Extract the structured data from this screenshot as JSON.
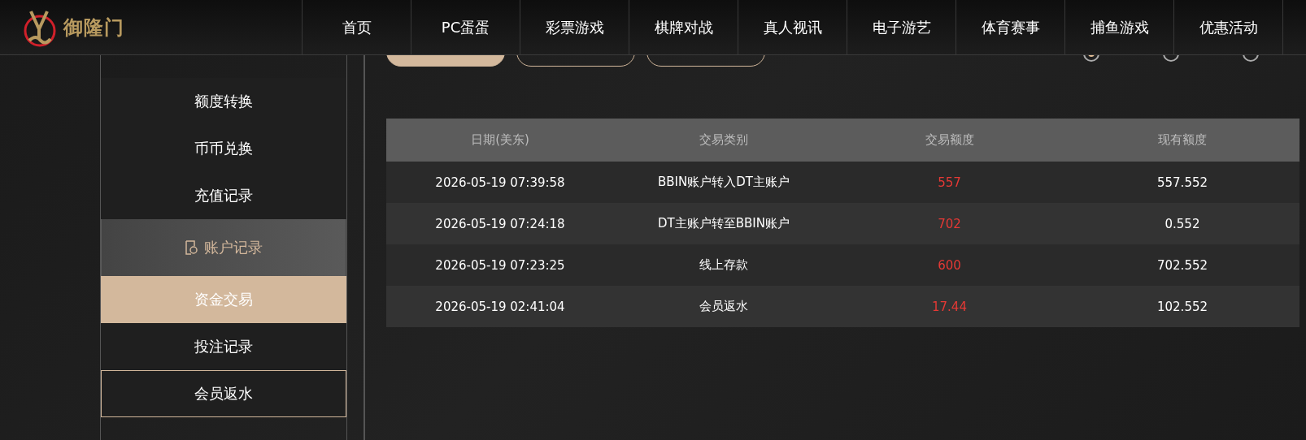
{
  "header": {
    "logo": {
      "name": "御隆门"
    },
    "nav": [
      {
        "label": "首页"
      },
      {
        "label": "PC蛋蛋"
      },
      {
        "label": "彩票游戏"
      },
      {
        "label": "棋牌对战"
      },
      {
        "label": "真人视讯"
      },
      {
        "label": "电子游艺"
      },
      {
        "label": "体育赛事"
      },
      {
        "label": "捕鱼游戏"
      },
      {
        "label": "优惠活动"
      }
    ]
  },
  "sidebar": {
    "items": [
      {
        "kind": "link",
        "selected": false,
        "highlighted": false
      },
      {
        "kind": "link",
        "label": "额度转换",
        "selected": false,
        "highlighted": false
      },
      {
        "kind": "link",
        "label": "币币兑换",
        "selected": false,
        "highlighted": false
      },
      {
        "kind": "link",
        "label": "充值记录",
        "selected": false,
        "highlighted": false
      },
      {
        "kind": "group",
        "label": "账户记录",
        "selected": false,
        "highlighted": false
      },
      {
        "kind": "link",
        "label": "资金交易",
        "selected": true,
        "highlighted": false
      },
      {
        "kind": "link",
        "label": "投注记录",
        "selected": false,
        "highlighted": false
      },
      {
        "kind": "link",
        "label": "会员返水",
        "selected": false,
        "highlighted": true
      },
      {
        "kind": "link",
        "selected": false,
        "highlighted": false
      }
    ]
  },
  "filters": [
    {
      "selected": true
    },
    {
      "selected": false
    },
    {
      "selected": false
    }
  ],
  "periods": [
    {
      "selected": true
    },
    {
      "selected": false
    },
    {
      "selected": false
    }
  ],
  "table": {
    "columns": [
      "日期(美东)",
      "交易类别",
      "交易额度",
      "现有额度"
    ],
    "rows": [
      [
        "2026-05-19 07:39:58",
        "BBIN账户转入DT主账户",
        "557",
        "557.552"
      ],
      [
        "2026-05-19 07:24:18",
        "DT主账户转至BBIN账户",
        "702",
        "0.552"
      ],
      [
        "2026-05-19 07:23:25",
        "线上存款",
        "600",
        "702.552"
      ],
      [
        "2026-05-19 02:41:04",
        "会员返水",
        "17.44",
        "102.552"
      ]
    ]
  }
}
